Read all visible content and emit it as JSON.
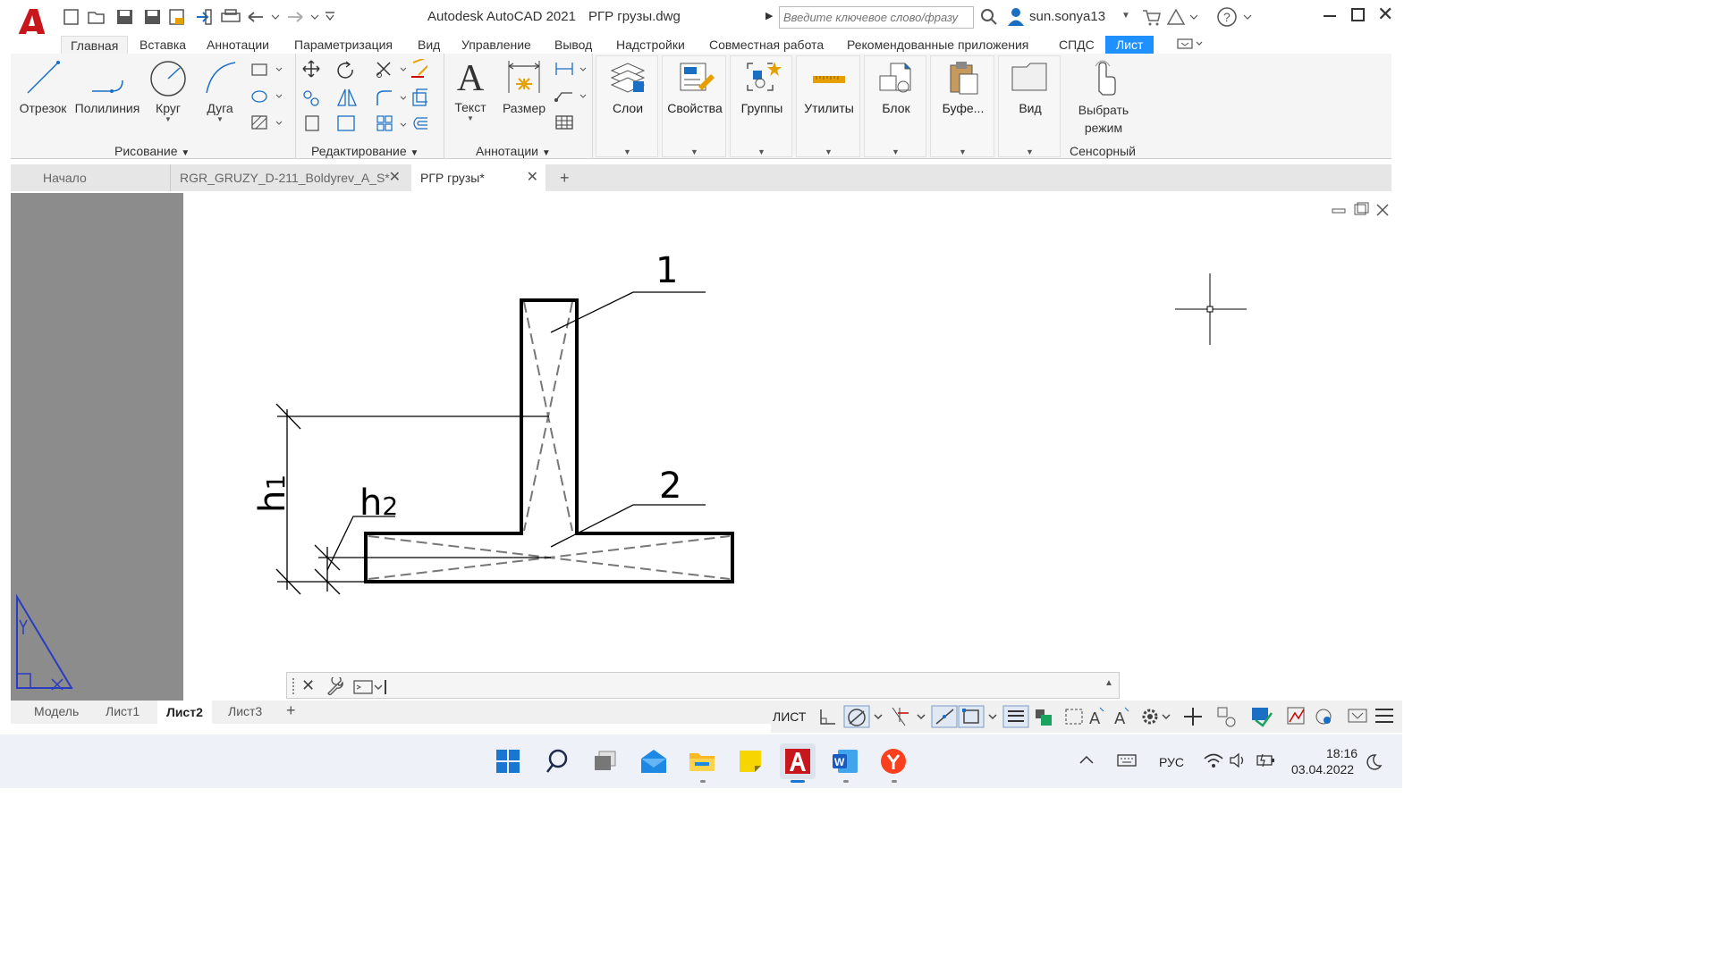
{
  "titlebar": {
    "app_title": "Autodesk AutoCAD 2021",
    "doc_title": "РГР грузы.dwg",
    "search_placeholder": "Введите ключевое слово/фразу",
    "user": "sun.sonya13"
  },
  "ribbon_tabs": [
    "Главная",
    "Вставка",
    "Аннотации",
    "Параметризация",
    "Вид",
    "Управление",
    "Вывод",
    "Надстройки",
    "Совместная работа",
    "Рекомендованные приложения",
    "СПДС",
    "Лист"
  ],
  "ribbon": {
    "draw_tools": [
      "Отрезок",
      "Полилиния",
      "Круг",
      "Дуга"
    ],
    "draw_panel": "Рисование",
    "modify_panel": "Редактирование",
    "annot_tools": [
      "Текст",
      "Размер"
    ],
    "annot_panel": "Аннотации",
    "groups": [
      "Слои",
      "Свойства",
      "Группы",
      "Утилиты",
      "Блок",
      "Буфе...",
      "Вид"
    ],
    "touch_label": "Выбрать режим",
    "touch_panel": "Сенсорный"
  },
  "doc_tabs": [
    "Начало",
    "RGR_GRUZY_D-211_Boldyrev_A_S*",
    "РГР грузы*"
  ],
  "drawing": {
    "label_1": "1",
    "label_2": "2",
    "dim_h1_main": "h",
    "dim_h1_sub": "1",
    "dim_h2_main": "h",
    "dim_h2_sub": "2"
  },
  "layout_tabs": [
    "Модель",
    "Лист1",
    "Лист2",
    "Лист3"
  ],
  "status": {
    "space": "ЛИСТ"
  },
  "tray": {
    "lang": "РУС",
    "time": "18:16",
    "date": "03.04.2022"
  }
}
